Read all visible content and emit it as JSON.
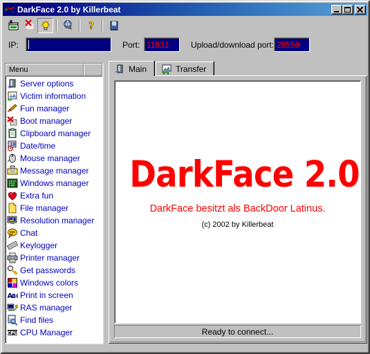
{
  "window": {
    "title": "DarkFace 2.0 by Killerbeat",
    "icon": "app-logo-icon",
    "buttons": {
      "minimize": "minimize-button",
      "maximize": "maximize-button",
      "close": "close-button"
    }
  },
  "toolbar": {
    "items": [
      {
        "name": "connect-icon",
        "tooltip": "Connect",
        "pressed": false
      },
      {
        "name": "disconnect-icon",
        "tooltip": "Disconnect",
        "pressed": false
      },
      {
        "name": "lightbulb-icon",
        "tooltip": "Tips",
        "pressed": true
      },
      {
        "name": "globe-icon",
        "tooltip": "Network",
        "pressed": false
      },
      {
        "name": "help-icon",
        "tooltip": "Help",
        "pressed": false
      },
      {
        "name": "exit-icon",
        "tooltip": "Exit",
        "pressed": false
      }
    ]
  },
  "connection": {
    "ip_label": "IP:",
    "ip_value": "",
    "ip_placeholder": "",
    "port_label": "Port:",
    "port_value": "11831",
    "updown_label": "Upload/download port:",
    "updown_value": "29559",
    "field_bg": "#000080",
    "field_text_color": "#ff0000"
  },
  "sidebar": {
    "header": "Menu",
    "items": [
      {
        "label": "Server options",
        "icon": "server-icon"
      },
      {
        "label": "Victim information",
        "icon": "victim-info-icon"
      },
      {
        "label": "Fun manager",
        "icon": "fun-icon"
      },
      {
        "label": "Boot manager",
        "icon": "boot-icon"
      },
      {
        "label": "Clipboard manager",
        "icon": "clipboard-icon"
      },
      {
        "label": "Date/time",
        "icon": "clock-icon"
      },
      {
        "label": "Mouse manager",
        "icon": "mouse-icon"
      },
      {
        "label": "Message manager",
        "icon": "message-icon"
      },
      {
        "label": "Windows manager",
        "icon": "windows-icon"
      },
      {
        "label": "Extra fun",
        "icon": "extra-fun-icon"
      },
      {
        "label": "File manager",
        "icon": "file-icon"
      },
      {
        "label": "Resolution manager",
        "icon": "monitor-icon"
      },
      {
        "label": "Chat",
        "icon": "chat-icon"
      },
      {
        "label": "Keylogger",
        "icon": "keylogger-icon"
      },
      {
        "label": "Printer manager",
        "icon": "printer-icon"
      },
      {
        "label": "Get passwords",
        "icon": "key-icon"
      },
      {
        "label": "Windows colors",
        "icon": "colors-icon"
      },
      {
        "label": "Print in screen",
        "icon": "abc-icon"
      },
      {
        "label": "RAS manager",
        "icon": "ras-icon"
      },
      {
        "label": "CPU Manager",
        "icon": "cpu-icon"
      }
    ],
    "extra_items": [
      {
        "label": "Find files",
        "icon": "find-files-icon"
      }
    ]
  },
  "tabs": [
    {
      "label": "Main",
      "icon": "main-tab-icon",
      "active": true
    },
    {
      "label": "Transfer",
      "icon": "transfer-tab-icon",
      "active": false
    }
  ],
  "main": {
    "brand_title": "DarkFace 2.0",
    "brand_subtitle": "DarkFace besitzt als BackDoor Latinus.",
    "copyright": "(c) 2002 by Killerbeat",
    "brand_color": "#ff0000"
  },
  "status": {
    "message": "Ready to connect..."
  }
}
